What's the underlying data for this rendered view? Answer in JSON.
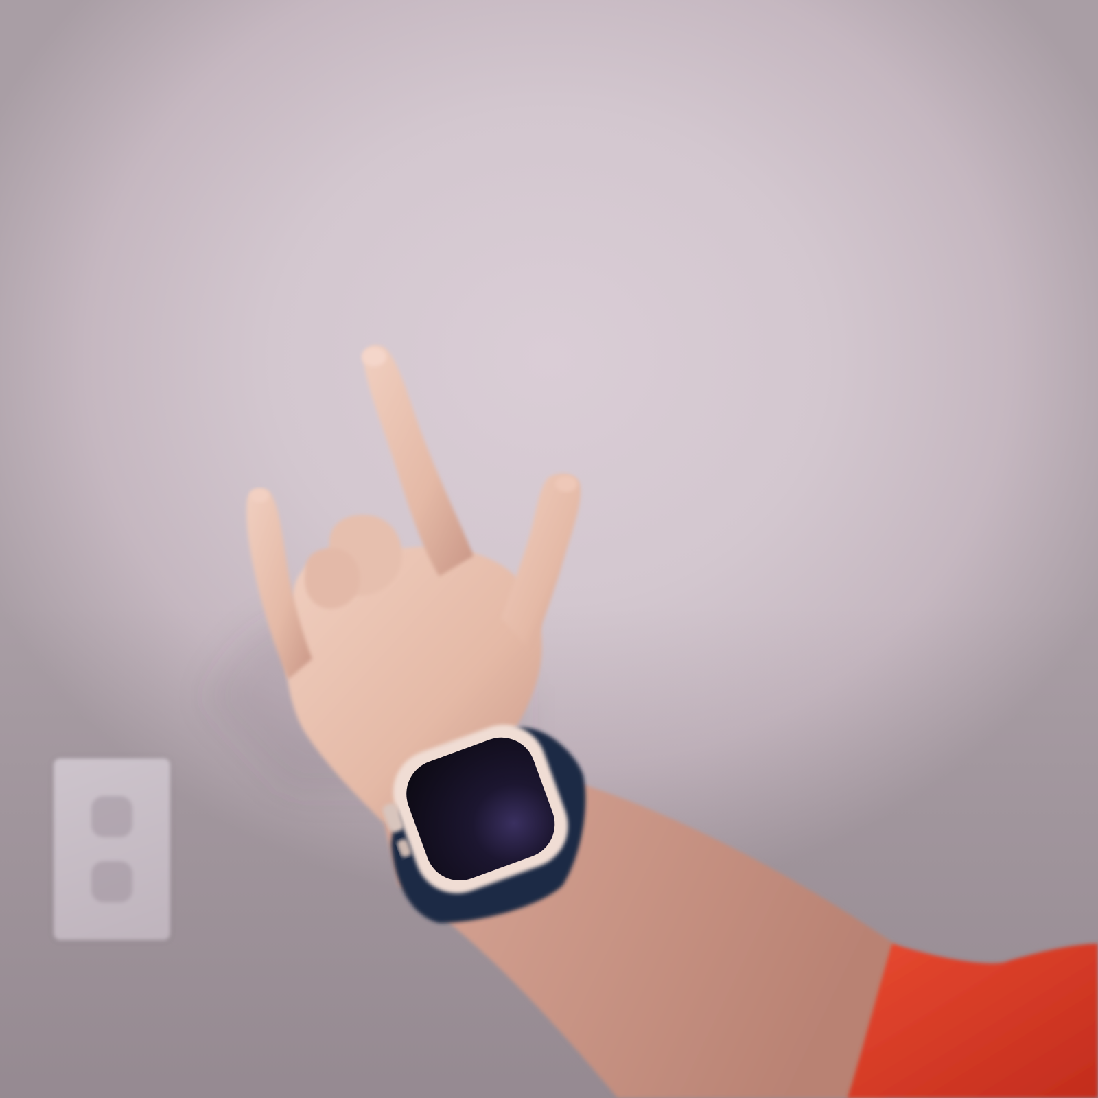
{
  "scene": {
    "description_free": true,
    "colors": {
      "wall": "#d6cad2",
      "skin": "#e9c3b0",
      "skin_shadow": "#c9998a",
      "sleeve": "#d83a26",
      "watch_case": "#f0dcd4",
      "watch_screen": "#14101c",
      "watch_band": "#1d2a44"
    },
    "icons": [
      "hand",
      "smartwatch",
      "wall-outlet",
      "sleeve"
    ]
  }
}
